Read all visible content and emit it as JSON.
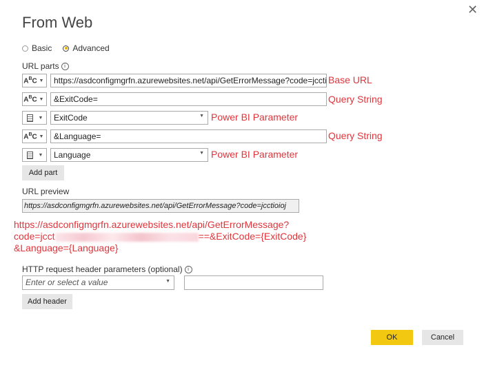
{
  "window": {
    "title": "From Web",
    "close_glyph": "✕"
  },
  "mode": {
    "basic_label": "Basic",
    "advanced_label": "Advanced",
    "selected": "Advanced"
  },
  "url_parts": {
    "label": "URL parts",
    "info_glyph": "i",
    "parts": [
      {
        "type_icon": "abc-text-icon",
        "value": "https://asdconfigmgrfn.azurewebsites.net/api/GetErrorMessage?code=jcctioioj",
        "annotation": "Base URL"
      },
      {
        "type_icon": "abc-text-icon",
        "value": "&ExitCode=",
        "annotation": "Query String"
      },
      {
        "type_icon": "parameter-icon",
        "value": "ExitCode",
        "annotation": "Power BI Parameter"
      },
      {
        "type_icon": "abc-text-icon",
        "value": "&Language=",
        "annotation": "Query String"
      },
      {
        "type_icon": "parameter-icon",
        "value": "Language",
        "annotation": "Power BI Parameter"
      }
    ],
    "add_part_label": "Add part"
  },
  "url_preview": {
    "label": "URL preview",
    "value": "https://asdconfigmgrfn.azurewebsites.net/api/GetErrorMessage?code=jcctioioj"
  },
  "full_url": {
    "line1": "https://asdconfigmgrfn.azurewebsites.net/api/GetErrorMessage?",
    "line2_prefix": "code=jcct",
    "line2_suffix": "==&ExitCode={ExitCode}",
    "line3": "&Language={Language}"
  },
  "http_headers": {
    "label": "HTTP request header parameters (optional)",
    "info_glyph": "i",
    "select_placeholder": "Enter or select a value",
    "value": "",
    "add_header_label": "Add header"
  },
  "footer": {
    "ok_label": "OK",
    "cancel_label": "Cancel"
  },
  "colors": {
    "annotation": "#e0343a",
    "ok_button": "#f2c811",
    "button": "#e6e6e6"
  }
}
